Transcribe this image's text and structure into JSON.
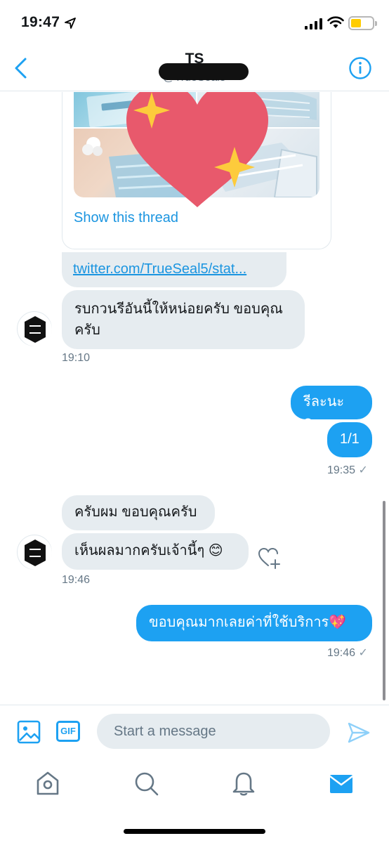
{
  "status_bar": {
    "time": "19:47"
  },
  "header": {
    "title": "TS",
    "handle": "@TrueSeal5"
  },
  "thread": {
    "show_thread_label": "Show this thread",
    "link_text": "twitter.com/TrueSeal5/stat..."
  },
  "messages": [
    {
      "from": "them",
      "text": "รบกวนรีอันนี้ให้หน่อยครับ ขอบคุณครับ",
      "time": "19:10"
    },
    {
      "from": "me",
      "text": "รีละนะคะ"
    },
    {
      "from": "me",
      "text": "1/1",
      "time": "19:35"
    },
    {
      "from": "them",
      "text": "ครับผม ขอบคุณครับ"
    },
    {
      "from": "them",
      "text": "เห็นผลมากครับเจ้านี้ๆ 😊",
      "time": "19:46"
    },
    {
      "from": "me",
      "text": "ขอบคุณมากเลยค่าที่ใช้บริการ💖",
      "time": "19:46"
    }
  ],
  "read_mark": "✓",
  "composer": {
    "placeholder": "Start a message",
    "gif_label": "GIF"
  },
  "colors": {
    "accent": "#1da1f2",
    "bubble_received": "#e6ecf0",
    "secondary_text": "#657786"
  },
  "icons": {
    "status": [
      "location-arrow-icon",
      "signal-icon",
      "wifi-icon",
      "battery-icon"
    ],
    "header": [
      "back-chevron-icon",
      "info-icon"
    ],
    "composer": [
      "image-icon",
      "gif-icon",
      "send-icon"
    ],
    "tabs": [
      "home-icon",
      "search-icon",
      "notifications-bell-icon",
      "messages-envelope-icon"
    ]
  }
}
